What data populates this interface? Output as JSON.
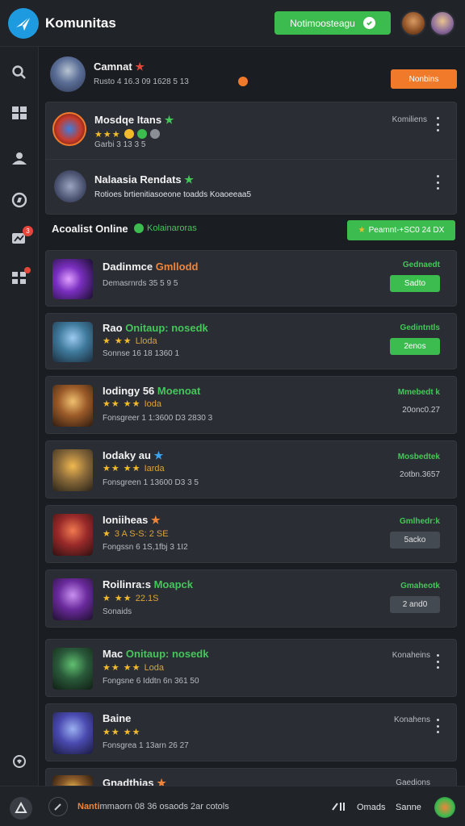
{
  "app": {
    "title": "Komunitas",
    "top_button": "Notimoosteagu"
  },
  "profile": {
    "name": "Camnat",
    "meta": "Rusto 4 16.3 09 1628 5 13",
    "button": "Nonbins"
  },
  "panel": {
    "item1": {
      "name": "Mosdqe Itans",
      "status": "Komiliens",
      "meta": "Garbi 3 13 3 5"
    },
    "item2": {
      "name": "Nalaasia Rendats",
      "sub": "Rotioes brtienitiasoeone toadds Koaoeeaa5"
    }
  },
  "section": {
    "title": "Acoalist Online",
    "subtitle": "Kolainaroras",
    "button": "Peamnt-+SC0 24 DX"
  },
  "games": [
    {
      "title": "Dadinmce",
      "accent": "Gmllodd",
      "meta": "Demasrnrds 35 5 9 5",
      "status": "Gednaedt",
      "action": "Sadto",
      "stars": ""
    },
    {
      "title": "Rao",
      "accent": "Onitaup: nosedk",
      "stars_text": "Lloda",
      "meta": "Sonnse 16 18 1360 1",
      "status": "Gedintntls",
      "action": "2enos"
    },
    {
      "title": "Iodingy 56",
      "accent": "Moenoat",
      "stars_text": "Ioda",
      "meta": "Fonsgreer 1 1:3600 D3 2830 3",
      "status": "Mmebedt k",
      "time": "20onc0.27"
    },
    {
      "title": "Iodaky au",
      "accent": "",
      "stars_text": "Iarda",
      "meta": "Fonsgreen 1 13600 D3 3 5",
      "status": "Mosbedtek",
      "time": "2otbn.3657"
    },
    {
      "title": "Ioniiheas",
      "accent": "",
      "stars_text": "3 A S-S: 2 SE",
      "meta": "Fongssn 6 1S,1fbj 3 1I2",
      "status": "Gmlhedr:k",
      "action": "5acko"
    },
    {
      "title": "Roilinra:s",
      "accent": "Moapck",
      "stars_text": "22.1S",
      "meta": "Sonaids",
      "status": "Gmaheotk",
      "action": "2 and0"
    },
    {
      "title": "Mac",
      "accent": "Onitaup: nosedk",
      "stars_text": "Loda",
      "meta": "Fongsne 6 Iddtn 6n 361 50",
      "status": "Konaheins"
    },
    {
      "title": "Baine",
      "accent": "",
      "stars_text": "",
      "meta": "Fonsgrea 1 13arn 26 27",
      "status": "Konahens"
    },
    {
      "title": "Gnadthias",
      "accent": "",
      "status": "Gaedions"
    }
  ],
  "bottom": {
    "text_accent": "Nanti",
    "text": "mmaorn 08 36 osaods 2ar cotols",
    "label1": "Omads",
    "label2": "Sanne"
  },
  "colors": {
    "green": "#3cbb4e",
    "orange": "#f07a2a",
    "blue": "#1e9be0",
    "bg": "#1a1d21"
  }
}
